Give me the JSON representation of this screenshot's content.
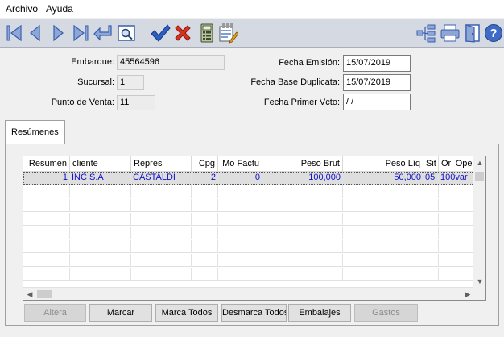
{
  "menu": {
    "items": [
      "Archivo",
      "Ayuda"
    ]
  },
  "toolbar": {
    "left_icons": [
      "first-record-icon",
      "previous-record-icon",
      "next-record-icon",
      "last-record-icon",
      "return-icon",
      "preview-icon",
      "confirm-icon",
      "cancel-icon",
      "calculator-icon",
      "edit-document-icon"
    ],
    "right_icons": [
      "tree-structure-icon",
      "printer-icon",
      "exit-door-icon",
      "help-icon"
    ]
  },
  "header": {
    "embarque_label": "Embarque:",
    "embarque_value": "45564596",
    "sucursal_label": "Sucursal:",
    "sucursal_value": "1",
    "punto_venta_label": "Punto de Venta:",
    "punto_venta_value": "11",
    "fecha_emision_label": "Fecha Emisión:",
    "fecha_emision_value": "15/07/2019",
    "fecha_base_label": "Fecha Base Duplicata:",
    "fecha_base_value": "15/07/2019",
    "fecha_primer_label": "Fecha Primer Vcto:",
    "fecha_primer_value": " / /"
  },
  "tab": {
    "label": "Resúmenes"
  },
  "grid": {
    "columns": [
      "Resumen",
      "cliente",
      "Repres",
      "Cpg",
      "Mo Factu",
      "Peso Brut",
      "Peso Líq",
      "Sit",
      "Ori Oper"
    ],
    "rows": [
      [
        "1",
        "INC  S.A",
        "CASTALDI",
        "2",
        "0",
        "100,000",
        "50,000",
        "05",
        "100var"
      ]
    ]
  },
  "buttons": {
    "altera": "Altera",
    "marcar": "Marcar",
    "marca_todos": "Marca Todos",
    "desmarca_todos": "Desmarca Todos",
    "embalajes": "Embalajes",
    "gastos": "Gastos"
  },
  "colors": {
    "toolbar_bg": "#d4d9e2",
    "icon_blue": "#3a5fb0",
    "check_blue": "#2c5fc4",
    "cancel_red": "#d8321e",
    "grid_text": "#1010c8"
  }
}
